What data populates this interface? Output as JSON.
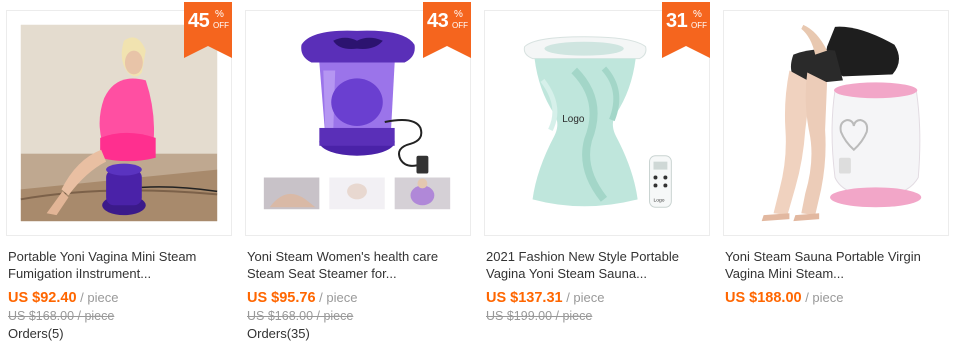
{
  "products": [
    {
      "discount": "45",
      "pct": "%",
      "off": "OFF",
      "title_line1": "Portable Yoni Vagina Mini Steam",
      "title_line2": "Fumigation iInstrument...",
      "price": "US $92.40",
      "unit": " / piece",
      "original": "US $168.00 / piece",
      "orders": "Orders(5)"
    },
    {
      "discount": "43",
      "pct": "%",
      "off": "OFF",
      "title_line1": "Yoni Steam Women's health care",
      "title_line2": "Steam Seat Steamer for...",
      "price": "US $95.76",
      "unit": " / piece",
      "original": "US $168.00 / piece",
      "orders": "Orders(35)"
    },
    {
      "discount": "31",
      "pct": "%",
      "off": "OFF",
      "title_line1": "2021 Fashion New Style Portable",
      "title_line2": "Vagina Yoni Steam Sauna...",
      "price": "US $137.31",
      "unit": " / piece",
      "original": "US $199.00 / piece",
      "logo_text": "Logo",
      "remote_logo": "Logo"
    },
    {
      "title_line1": "Yoni Steam Sauna Portable Virgin",
      "title_line2": "Vagina Mini Steam...",
      "price": "US $188.00",
      "unit": " / piece"
    }
  ],
  "colors": {
    "badge": "#f5651e",
    "price": "#ff6600",
    "muted": "#999999"
  }
}
